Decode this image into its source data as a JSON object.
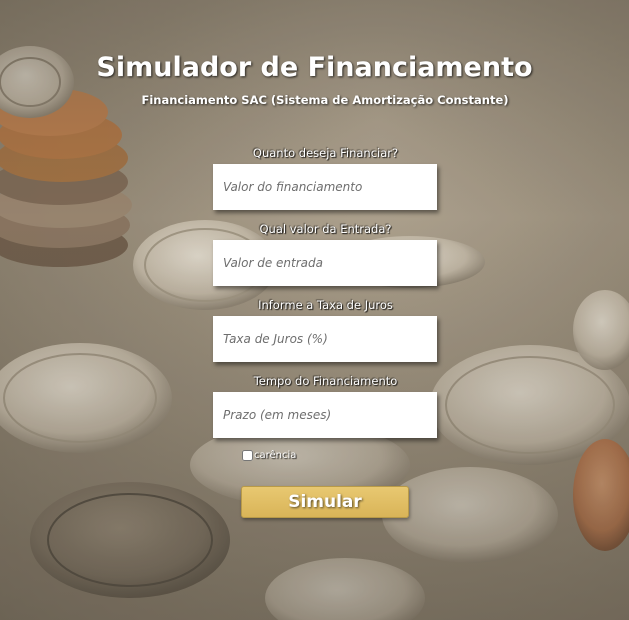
{
  "header": {
    "title": "Simulador de Financiamento",
    "subtitle": "Financiamento SAC (Sistema de Amortização Constante)"
  },
  "form": {
    "fields": [
      {
        "label": "Quanto deseja Financiar?",
        "placeholder": "Valor do financiamento",
        "value": ""
      },
      {
        "label": "Qual valor da Entrada?",
        "placeholder": "Valor de entrada",
        "value": ""
      },
      {
        "label": "Informe a Taxa de Juros",
        "placeholder": "Taxa de Juros (%)",
        "value": ""
      },
      {
        "label": "Tempo do Financiamento",
        "placeholder": "Prazo (em meses)",
        "value": ""
      }
    ],
    "checkbox": {
      "label": "carência",
      "checked": false
    },
    "submit_label": "Simular"
  },
  "background": {
    "description_icon": "coins-photo",
    "button_color": "#e2bf63"
  }
}
